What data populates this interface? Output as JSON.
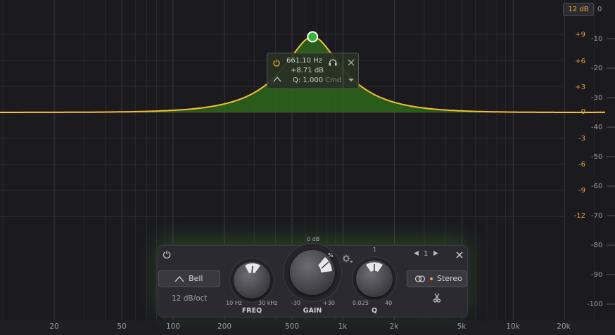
{
  "range_button": {
    "label": "12 dB"
  },
  "range_zero": {
    "label": "0"
  },
  "gain_scale": [
    "+9",
    "+6",
    "+3",
    "0",
    "-3",
    "-6",
    "-9",
    "-12"
  ],
  "analyzer_scale": [
    "-10",
    "-20",
    "-30",
    "-40",
    "-50",
    "-60",
    "-70",
    "-80",
    "-90",
    "-100"
  ],
  "freq_axis": [
    "20",
    "50",
    "100",
    "200",
    "500",
    "1k",
    "2k",
    "5k",
    "10k",
    "20k"
  ],
  "band": {
    "frequency_hz": 661.1,
    "gain_db": 8.71,
    "q": 1.0,
    "freq_text": "661.10 Hz",
    "gain_text": "+8.71 dB",
    "q_text": "Q: 1.000",
    "modifier_hint": "Cmd"
  },
  "panel": {
    "shape_label": "Bell",
    "slope_label": "12 dB/oct",
    "freq": {
      "caption": "FREQ",
      "min_label": "10 Hz",
      "max_label": "30 kHz"
    },
    "gain": {
      "caption": "GAIN",
      "min_label": "-30",
      "max_label": "+30",
      "top_label": "0 dB",
      "percent_label": "%"
    },
    "q": {
      "caption": "Q",
      "min_label": "0.025",
      "max_label": "40",
      "top_label": "1"
    },
    "band_number": "1",
    "stereo_label": "Stereo"
  },
  "colors": {
    "curve": "#f3c22f",
    "fill": "#2f6b1a",
    "node": "#36b43a",
    "db_label": "#e4a93a",
    "background": "#1b1a1f"
  }
}
